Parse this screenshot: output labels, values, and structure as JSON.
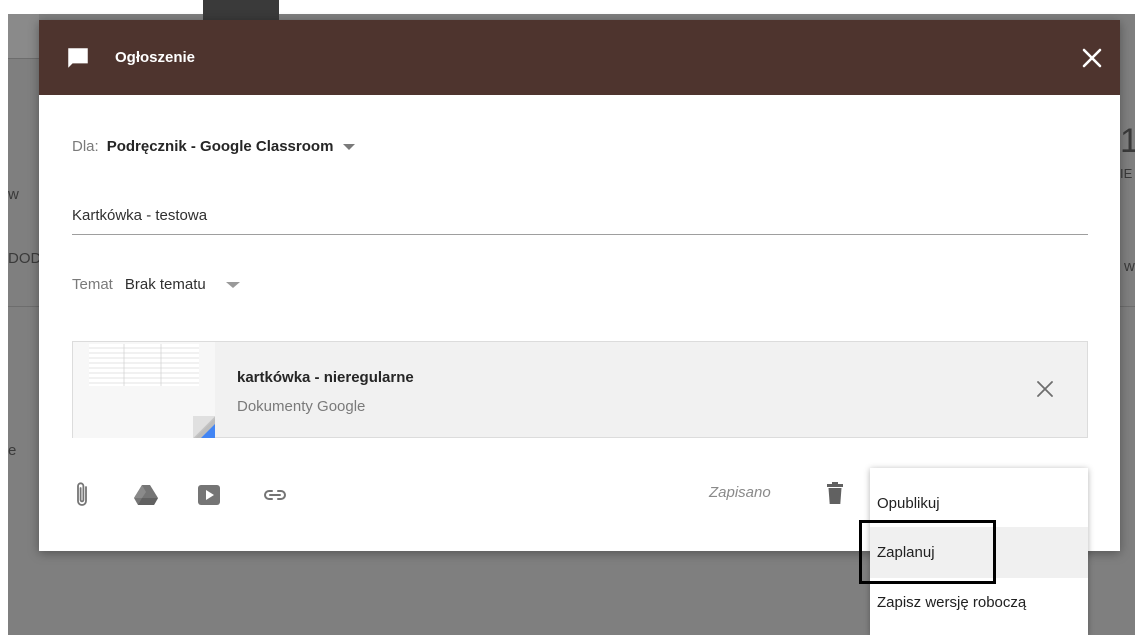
{
  "background": {
    "left_labels": [
      "w",
      "DOD",
      "e"
    ],
    "right_labels": [
      "1",
      "IE",
      "w"
    ]
  },
  "modal": {
    "header_icon": "chat-bubble-icon",
    "title": "Ogłoszenie",
    "close_icon": "close-icon",
    "header_color": "#4e342e"
  },
  "audience": {
    "label": "Dla:",
    "course": "Podręcznik - Google Classroom"
  },
  "post_title": {
    "value": "Kartkówka - testowa"
  },
  "topic": {
    "label": "Temat",
    "value": "Brak tematu"
  },
  "attachment": {
    "title": "kartkówka - nieregularne",
    "type": "Dokumenty Google",
    "remove_icon": "close-icon"
  },
  "toolbar": {
    "icons": [
      "paperclip-icon",
      "google-drive-icon",
      "youtube-icon",
      "link-icon"
    ],
    "status": "Zapisano",
    "delete_icon": "trash-icon"
  },
  "menu": {
    "items": [
      "Opublikuj",
      "Zaplanuj",
      "Zapisz wersję roboczą"
    ],
    "highlighted": "Zaplanuj"
  }
}
